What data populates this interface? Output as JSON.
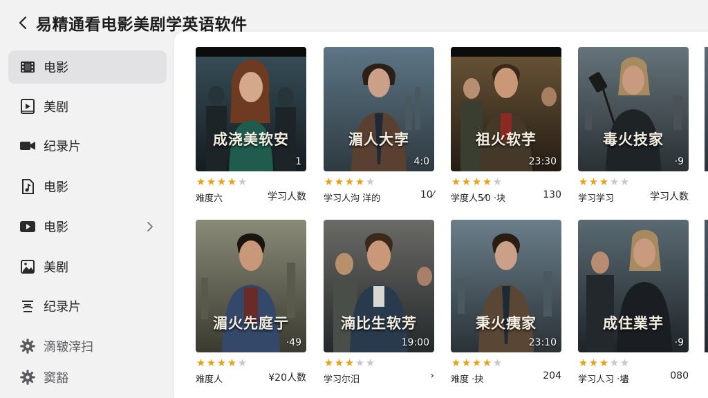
{
  "header": {
    "title": "易精通看电影美剧学英语软件"
  },
  "sidebar": {
    "items": [
      {
        "label": "电影",
        "icon": "film-icon",
        "active": true
      },
      {
        "label": "美剧",
        "icon": "play-square-icon"
      },
      {
        "label": "纪录片",
        "icon": "video-camera-icon"
      },
      {
        "label": "电影",
        "icon": "music-file-icon"
      },
      {
        "label": "电影",
        "icon": "youtube-play-icon",
        "has_chevron": true
      },
      {
        "label": "美剧",
        "icon": "image-icon"
      },
      {
        "label": "纪录片",
        "icon": "subtitles-icon"
      },
      {
        "label": "滴皲滓扫",
        "icon": "gear-icon",
        "muted": true
      },
      {
        "label": "窦豁",
        "icon": "gear-icon",
        "muted": true
      }
    ]
  },
  "cards": [
    {
      "title": "成浇美软安",
      "duration": "1",
      "rating": 4,
      "meta_left": "难度六",
      "meta_right": "学习人数"
    },
    {
      "title": "湄人大孛",
      "duration": "4:0",
      "rating": 4,
      "meta_left": "学习人沟  洋的",
      "meta_right": "10⁄"
    },
    {
      "title": "祖火软芋",
      "duration": "23:30",
      "rating": 4,
      "meta_left": "学度人5⁄0  ·块",
      "meta_right": "130"
    },
    {
      "title": "毒火技家",
      "duration": "·9",
      "rating": 3,
      "meta_left": "学习学习",
      "meta_right": "学习人数"
    },
    {
      "title": "湄火先庭亍",
      "duration": "·49",
      "rating": 4,
      "meta_left": "难度人",
      "meta_right": "¥20人数"
    },
    {
      "title": "湳比生软芳",
      "duration": "19:00",
      "rating": 3,
      "meta_left": "学习尔汨",
      "meta_right": "›"
    },
    {
      "title": "秉火痍家",
      "duration": "23:10",
      "rating": 4,
      "meta_left": "难度      ·抉",
      "meta_right": "204"
    },
    {
      "title": "成住業芋",
      "duration": "·9",
      "rating": 3,
      "meta_left": "学习人习  ·壗",
      "meta_right": "080"
    }
  ],
  "colors": {
    "star_on": "#e8a317",
    "star_off": "#c9c9cc",
    "active_nav": "#e2e2e4",
    "background": "#f2f2f3",
    "content_bg": "#ffffff"
  }
}
